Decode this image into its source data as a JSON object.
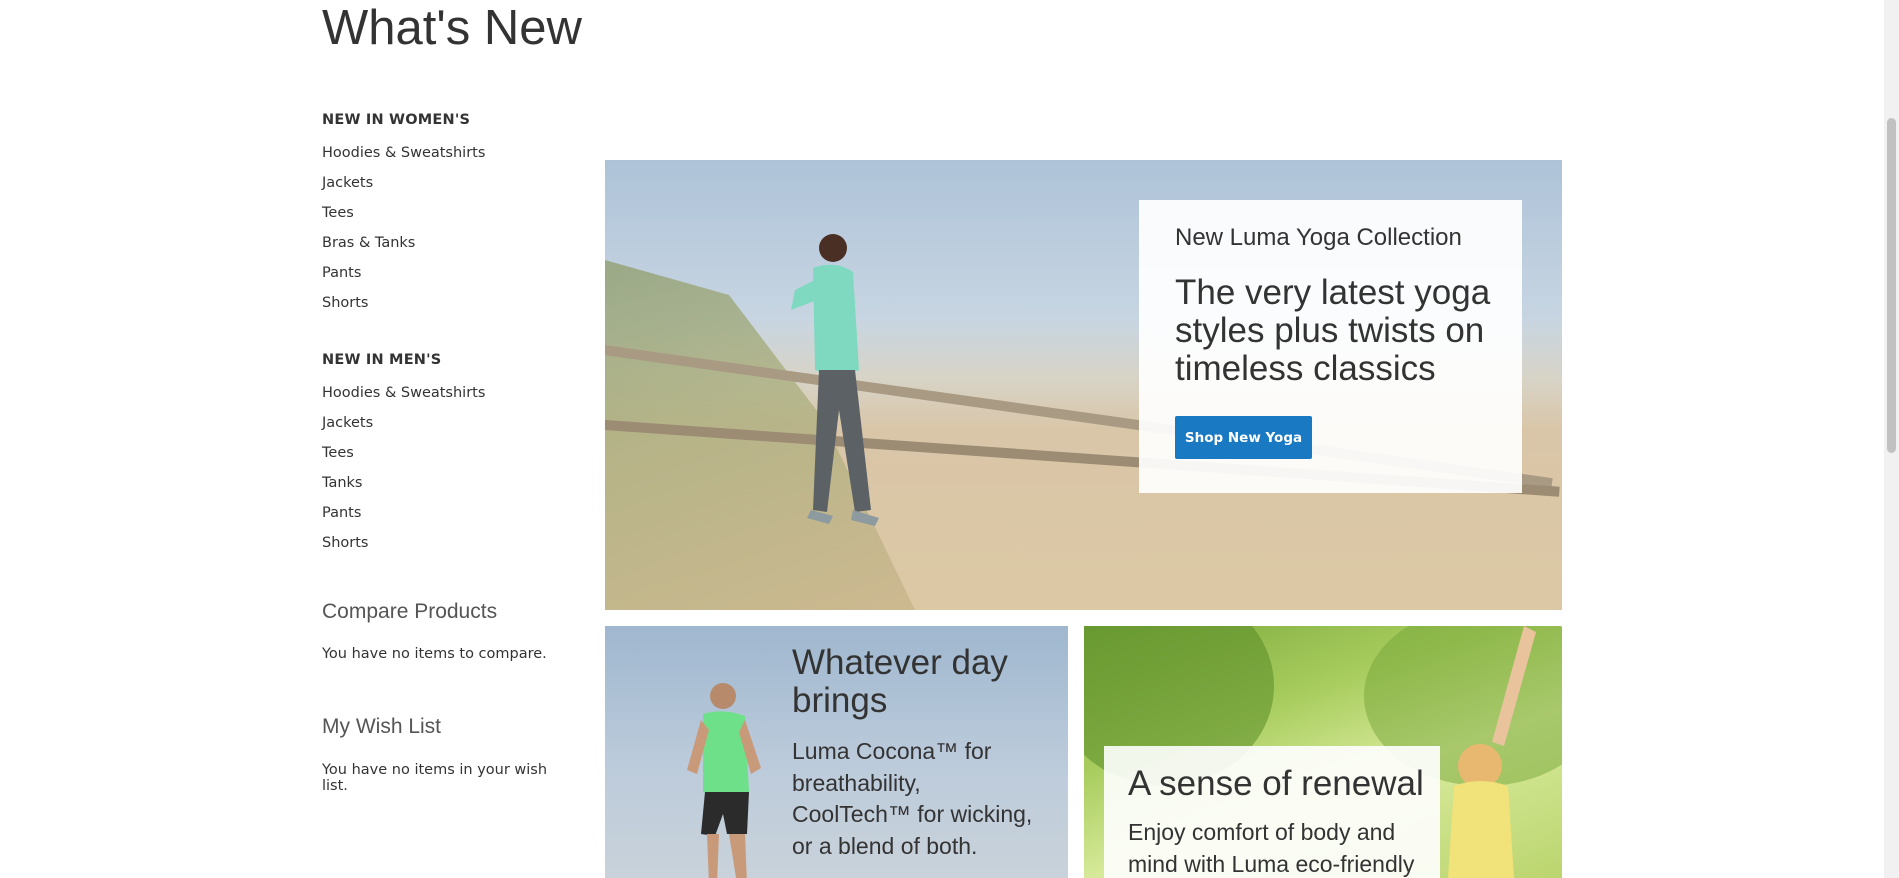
{
  "page": {
    "title": "What's New"
  },
  "sidebar": {
    "women": {
      "title": "NEW IN WOMEN'S",
      "items": [
        "Hoodies & Sweatshirts",
        "Jackets",
        "Tees",
        "Bras & Tanks",
        "Pants",
        "Shorts"
      ]
    },
    "men": {
      "title": "NEW IN MEN'S",
      "items": [
        "Hoodies & Sweatshirts",
        "Jackets",
        "Tees",
        "Tanks",
        "Pants",
        "Shorts"
      ]
    },
    "compare": {
      "title": "Compare Products",
      "text": "You have no items to compare."
    },
    "wishlist": {
      "title": "My Wish List",
      "text": "You have no items in your wish list."
    }
  },
  "hero": {
    "subtitle": "New Luma Yoga Collection",
    "headline": "The very latest yoga styles plus twists on timeless classics",
    "button_label": "Shop New Yoga"
  },
  "tile_left": {
    "headline": "Whatever day brings",
    "text": "Luma Cocona™ for breathability, CoolTech™ for wicking, or a blend of both."
  },
  "tile_right": {
    "headline": "A sense of renewal",
    "text": "Enjoy comfort of body and mind with Luma eco-friendly"
  },
  "colors": {
    "accent": "#1979c3",
    "text": "#333333"
  }
}
